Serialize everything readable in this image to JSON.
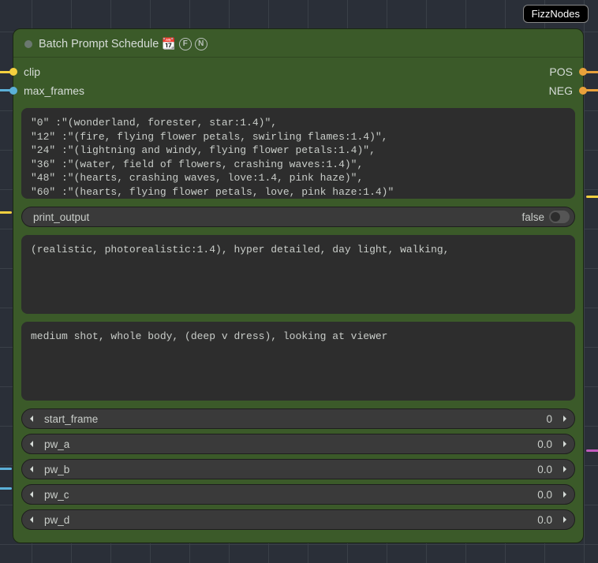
{
  "badge": "FizzNodes",
  "node": {
    "title": "Batch Prompt Schedule",
    "title_icons": [
      "📆",
      "F",
      "N"
    ],
    "inputs": [
      {
        "name": "clip",
        "color": "#f4d03f"
      },
      {
        "name": "max_frames",
        "color": "#5bb0d8"
      }
    ],
    "outputs": [
      {
        "name": "POS",
        "color": "#e9a13b"
      },
      {
        "name": "NEG",
        "color": "#e9a13b"
      }
    ],
    "prompt_schedule": "\"0\" :\"(wonderland, forester, star:1.4)\",\n\"12\" :\"(fire, flying flower petals, swirling flames:1.4)\",\n\"24\" :\"(lightning and windy, flying flower petals:1.4)\",\n\"36\" :\"(water, field of flowers, crashing waves:1.4)\",\n\"48\" :\"(hearts, crashing waves, love:1.4, pink haze)\",\n\"60\" :\"(hearts, flying flower petals, love, pink haze:1.4)\"",
    "print_output": {
      "label": "print_output",
      "value": "false"
    },
    "text_a": "(realistic, photorealistic:1.4), hyper detailed, day light, walking,",
    "text_b": "medium shot, whole body, (deep v dress), looking at viewer",
    "spinners": [
      {
        "label": "start_frame",
        "value": "0"
      },
      {
        "label": "pw_a",
        "value": "0.0"
      },
      {
        "label": "pw_b",
        "value": "0.0"
      },
      {
        "label": "pw_c",
        "value": "0.0"
      },
      {
        "label": "pw_d",
        "value": "0.0"
      }
    ]
  }
}
